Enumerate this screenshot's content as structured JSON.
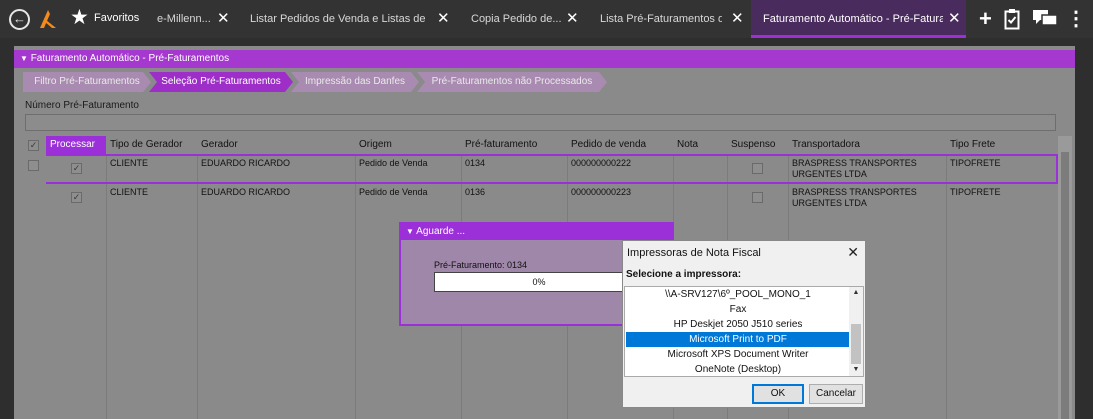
{
  "topbar": {
    "favorites_label": "Favoritos",
    "tabs": [
      {
        "label": "e-Millenn..."
      },
      {
        "label": "Listar Pedidos de Venda e Listas de Ca..."
      },
      {
        "label": "Copia Pedido de..."
      },
      {
        "label": "Lista Pré-Faturamentos d..."
      },
      {
        "label": "Faturamento Automático - Pré-Fatura..."
      }
    ],
    "close_glyph": "✕",
    "icons": [
      "back-icon",
      "logo-icon",
      "star-icon",
      "add-icon",
      "clipboard-icon",
      "chat-icon",
      "more-icon"
    ]
  },
  "window": {
    "title": "Faturamento Automático - Pré-Faturamentos",
    "steps": [
      {
        "label": "Filtro Pré-Faturamentos"
      },
      {
        "label": "Seleção Pré-Faturamentos"
      },
      {
        "label": "Impressão das Danfes"
      },
      {
        "label": "Pré-Faturamentos não Processados"
      }
    ],
    "numero_label": "Número Pré-Faturamento",
    "numero_value": ""
  },
  "grid": {
    "columns": [
      "Processar",
      "Tipo de Gerador",
      "Gerador",
      "Origem",
      "Pré-faturamento",
      "Pedido de venda",
      "Nota",
      "Suspenso",
      "Transportadora",
      "Tipo Frete"
    ],
    "rows": [
      {
        "tipo": "CLIENTE",
        "gerador": "EDUARDO RICARDO",
        "origem": "Pedido de Venda",
        "pre": "0134",
        "pedido": "000000000222",
        "nota": "",
        "transp1": "BRASPRESS TRANSPORTES",
        "transp2": "URGENTES LTDA",
        "frete": "TIPOFRETE"
      },
      {
        "tipo": "CLIENTE",
        "gerador": "EDUARDO RICARDO",
        "origem": "Pedido de Venda",
        "pre": "0136",
        "pedido": "000000000223",
        "nota": "",
        "transp1": "BRASPRESS TRANSPORTES",
        "transp2": "URGENTES LTDA",
        "frete": "TIPOFRETE"
      }
    ],
    "check_glyph": "✓"
  },
  "aguarde": {
    "title": "Aguarde ...",
    "label": "Pré-Faturamento: 0134",
    "progress_text": "0%",
    "progress": 0
  },
  "printer_dialog": {
    "title": "Impressoras de Nota Fiscal",
    "close": "✕",
    "label": "Selecione a impressora:",
    "printers": [
      "\\\\A-SRV127\\6º_POOL_MONO_1",
      "Fax",
      "HP Deskjet 2050 J510 series",
      "Microsoft Print to PDF",
      "Microsoft XPS Document Writer",
      "OneNote (Desktop)"
    ],
    "selected": "Microsoft Print to PDF",
    "ok_label": "OK",
    "cancel_label": "Cancelar"
  },
  "colors": {
    "accent": "#9b30d9",
    "selection": "#0078d7",
    "tabbar": "#333333"
  }
}
